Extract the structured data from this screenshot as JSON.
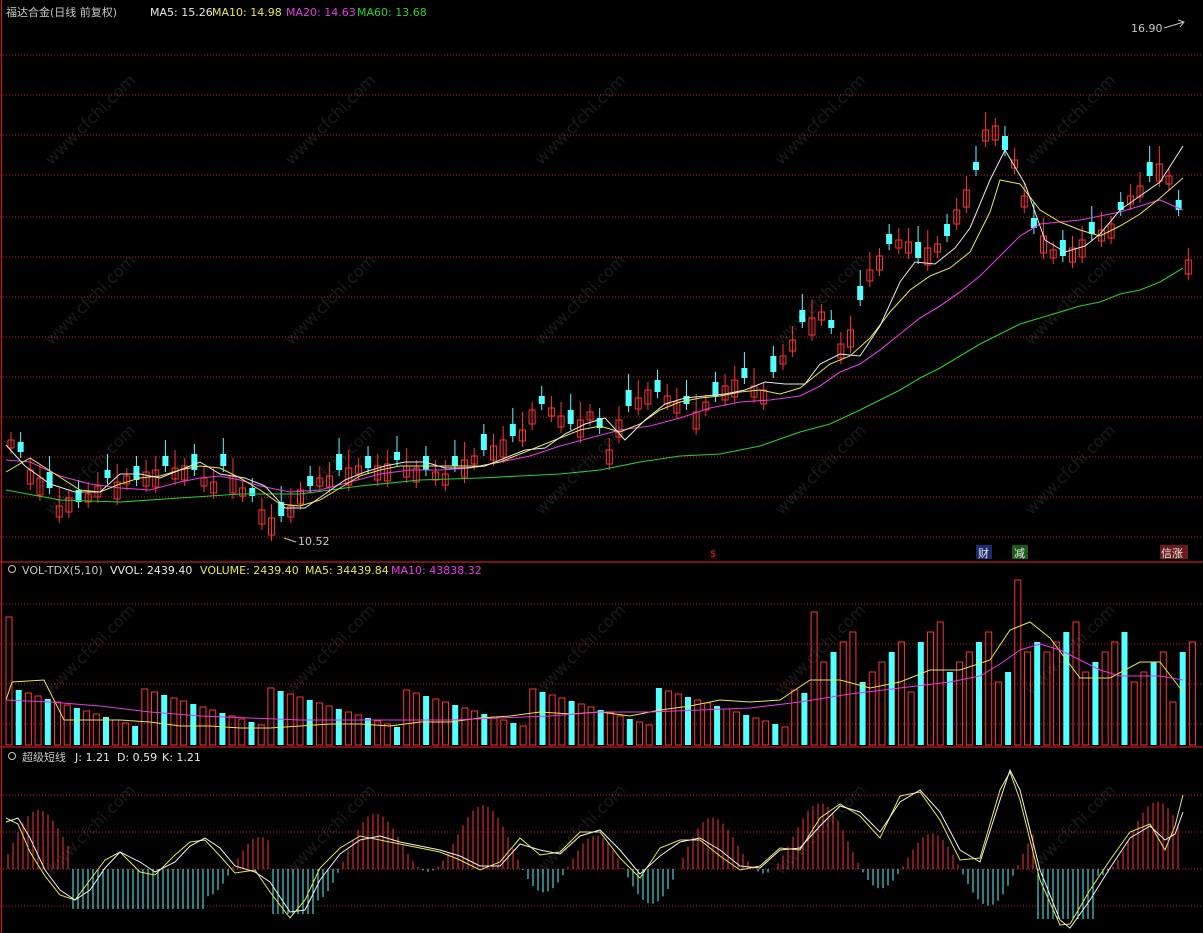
{
  "header": {
    "title": "福达合金(日线 前复权)",
    "ma5": "MA5: 15.26",
    "ma10": "MA10: 14.98",
    "ma20": "MA20: 14.63",
    "ma60": "MA60: 13.68",
    "high": "16.90",
    "low": "10.52"
  },
  "events": [
    "$",
    "财",
    "减",
    "信涨"
  ],
  "volume_panel": {
    "name": "VOL-TDX(5,10)",
    "vvol": "VVOL: 2439.40",
    "volume": "VOLUME: 2439.40",
    "ma5": "MA5: 34439.84",
    "ma10": "MA10: 43838.32"
  },
  "kdj_panel": {
    "name": "超级短线",
    "j": "J: 1.21",
    "d": "D: 0.59",
    "k": "K: 1.21"
  },
  "watermark": "www.cfchi.com",
  "colors": {
    "up": "#ff3333",
    "down": "#54ffff",
    "ma5": "#e8e8e8",
    "ma10": "#e8e84a",
    "ma20": "#e838e8",
    "ma60": "#27d127",
    "grid": "#c41a1a"
  }
}
